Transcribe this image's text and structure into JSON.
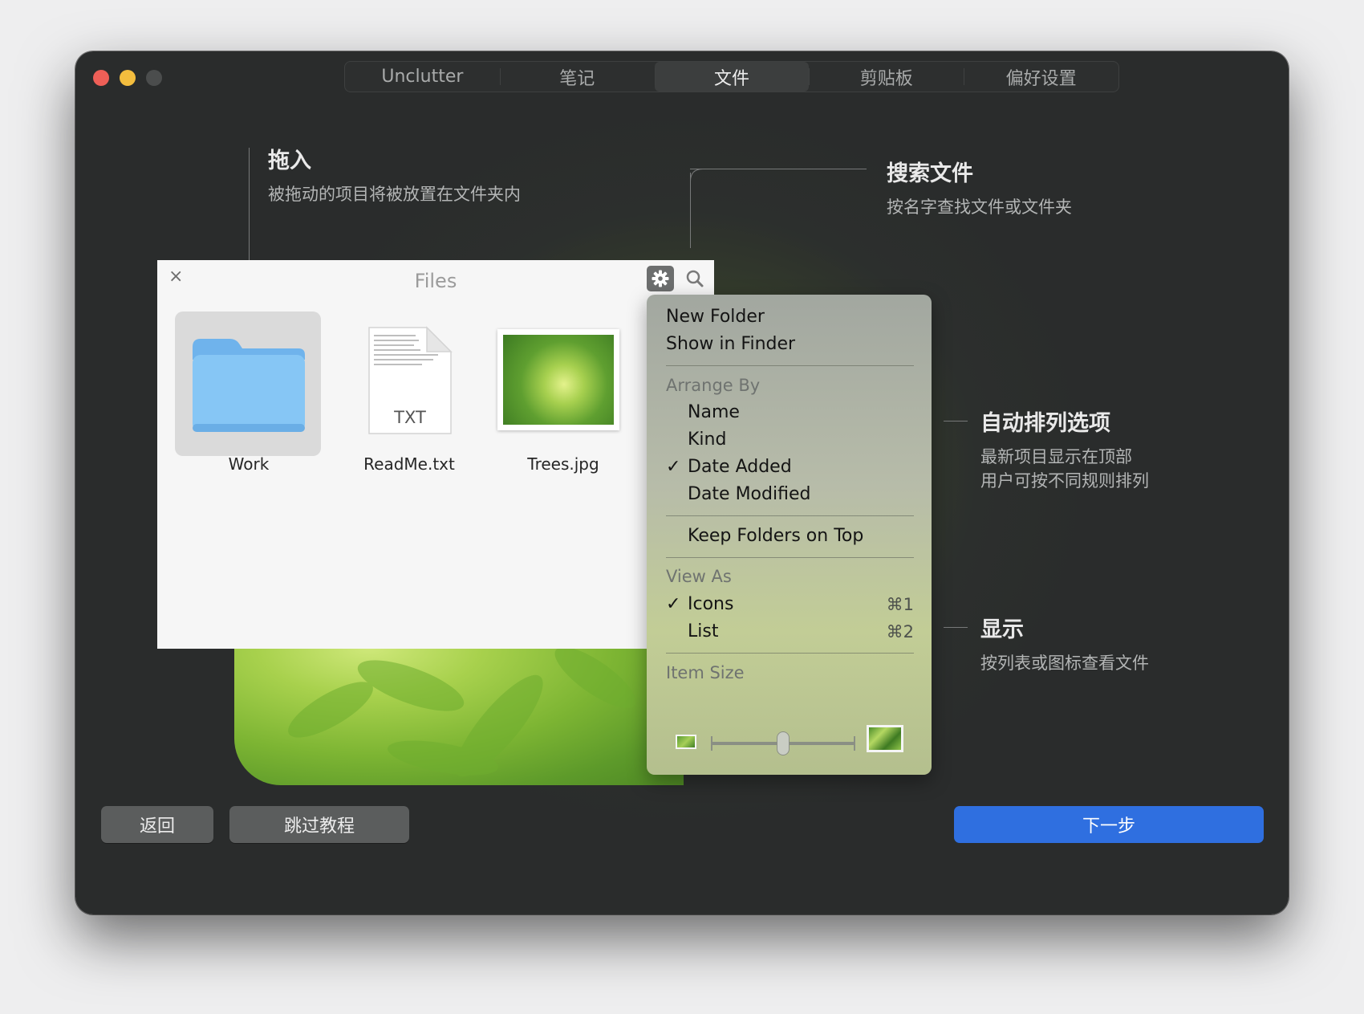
{
  "tabs": [
    "Unclutter",
    "笔记",
    "文件",
    "剪贴板",
    "偏好设置"
  ],
  "active_tab": "文件",
  "annotations": {
    "drag": {
      "title": "拖入",
      "subtitle": "被拖动的项目将被放置在文件夹内"
    },
    "search": {
      "title": "搜索文件",
      "subtitle": "按名字查找文件或文件夹"
    },
    "arrange": {
      "title": "自动排列选项",
      "subtitle_1": "最新项目显示在顶部",
      "subtitle_2": "用户可按不同规则排列"
    },
    "view": {
      "title": "显示",
      "subtitle": "按列表或图标查看文件"
    }
  },
  "files_panel": {
    "close_glyph": "×",
    "title": "Files",
    "items": [
      {
        "name": "Work",
        "kind": "folder",
        "selected": true
      },
      {
        "name": "ReadMe.txt",
        "kind": "txt",
        "badge": "TXT"
      },
      {
        "name": "Trees.jpg",
        "kind": "image"
      }
    ]
  },
  "menu": {
    "new_folder": "New Folder",
    "show_in_finder": "Show in Finder",
    "arrange_by": "Arrange By",
    "arrange_options": [
      "Name",
      "Kind",
      "Date Added",
      "Date Modified"
    ],
    "arrange_selected": "Date Added",
    "keep_folders": "Keep Folders on Top",
    "view_as": "View As",
    "view_icons": "Icons",
    "view_list": "List",
    "shortcut_icons": "⌘1",
    "shortcut_list": "⌘2",
    "view_selected": "Icons",
    "check_glyph": "✓",
    "item_size": "Item Size",
    "item_size_level": 0.5
  },
  "buttons": {
    "back": "返回",
    "skip": "跳过教程",
    "next": "下一步"
  },
  "colors": {
    "next_button": "#2f6fe0",
    "tl_close": "#ee5f57",
    "tl_min": "#f3bd3e",
    "folder": "#7fc0f3"
  }
}
